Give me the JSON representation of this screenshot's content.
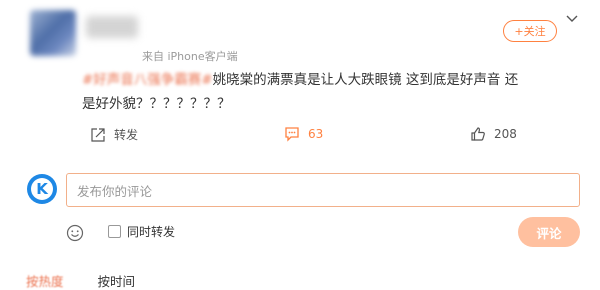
{
  "post": {
    "source": "来自 iPhone客户端",
    "follow_label": "+关注",
    "hashtag": "#好声音八强争霸赛#",
    "text": "姚晓棠的满票真是让人大跌眼镜 这到底是好声音 还是好外貌？？？？？？？"
  },
  "actions": {
    "repost_label": "转发",
    "comment_count": "63",
    "like_count": "208"
  },
  "composer": {
    "logo_letter": "K",
    "placeholder": "发布你的评论",
    "repost_checkbox_label": "同时转发",
    "submit_label": "评论"
  },
  "sort": {
    "hot_label": "按热度",
    "time_label": "按时间"
  },
  "colors": {
    "accent": "#ff8140",
    "hashtag": "#eb7350",
    "logo_blue": "#1e88e5"
  }
}
